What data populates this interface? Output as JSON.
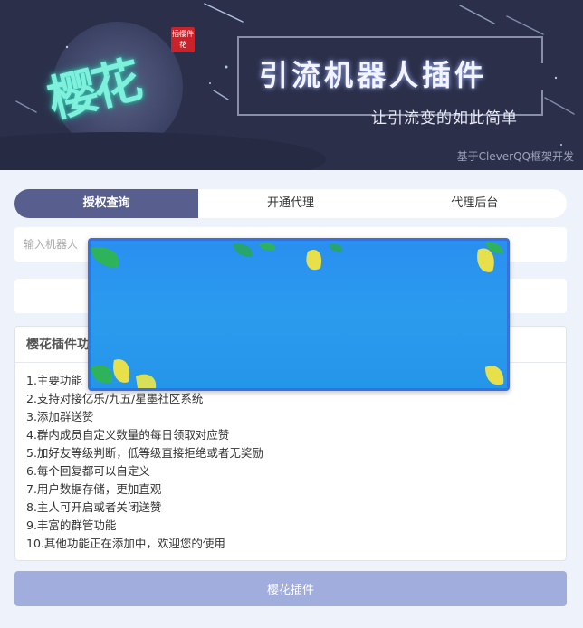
{
  "banner": {
    "logo_text": "樱花",
    "seal_text": "插樱件花",
    "main_title": "引流机器人插件",
    "subtitle": "让引流变的如此简单",
    "footer_note": "基于CleverQQ框架开发"
  },
  "tabs": [
    {
      "label": "授权查询",
      "active": true
    },
    {
      "label": "开通代理",
      "active": false
    },
    {
      "label": "代理后台",
      "active": false
    }
  ],
  "search": {
    "placeholder": "输入机器人",
    "value": ""
  },
  "panel": {
    "title": "樱花插件功",
    "items": [
      "1.主要功能",
      "2.支持对接亿乐/九五/星墨社区系统",
      "3.添加群送赞",
      "4.群内成员自定义数量的每日领取对应赞",
      "5.加好友等级判断，低等级直接拒绝或者无奖励",
      "6.每个回复都可以自定义",
      "7.用户数据存储，更加直观",
      "8.主人可开启或者关闭送赞",
      "9.丰富的群管功能",
      "10.其他功能正在添加中，欢迎您的使用"
    ]
  },
  "submit_label": "樱花插件",
  "colors": {
    "banner_bg": "#2b2f4a",
    "tab_active": "#585f8f",
    "submit_bg": "#a1aedd",
    "popup_bg": "#2a95ee",
    "logo_glow": "#7ff0dc"
  },
  "icons": [
    "leaf-icon",
    "shooting-star-icon"
  ]
}
